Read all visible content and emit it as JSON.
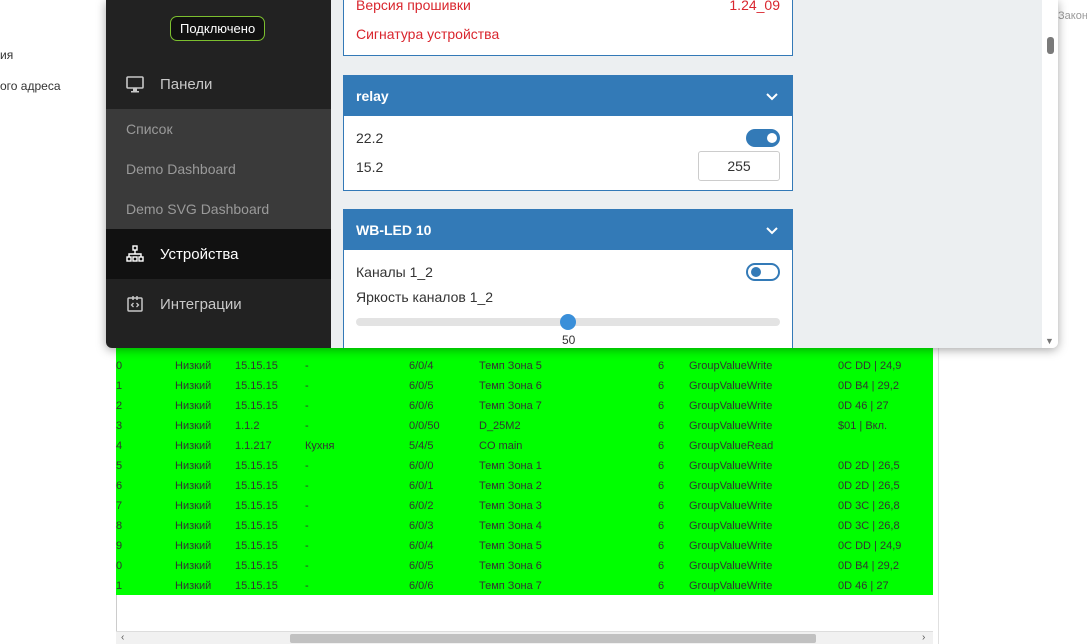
{
  "background": {
    "left_texts": [
      "ия",
      "ого адреса"
    ],
    "right_text": "Закон",
    "table_rows": [
      [
        "0",
        "Низкий",
        "15.15.15",
        "-",
        "6/0/4",
        "Темп Зона 5",
        "6",
        "GroupValueWrite",
        "0C DD | 24,9"
      ],
      [
        "1",
        "Низкий",
        "15.15.15",
        "-",
        "6/0/5",
        "Темп Зона 6",
        "6",
        "GroupValueWrite",
        "0D B4 | 29,2"
      ],
      [
        "2",
        "Низкий",
        "15.15.15",
        "-",
        "6/0/6",
        "Темп Зона 7",
        "6",
        "GroupValueWrite",
        "0D 46 | 27"
      ],
      [
        "3",
        "Низкий",
        "1.1.2",
        "-",
        "0/0/50",
        "D_25M2",
        "6",
        "GroupValueWrite",
        "$01 | Вкл."
      ],
      [
        "4",
        "Низкий",
        "1.1.217",
        "Кухня",
        "5/4/5",
        "CO main",
        "6",
        "GroupValueRead",
        ""
      ],
      [
        "5",
        "Низкий",
        "15.15.15",
        "-",
        "6/0/0",
        "Темп Зона 1",
        "6",
        "GroupValueWrite",
        "0D 2D | 26,5"
      ],
      [
        "6",
        "Низкий",
        "15.15.15",
        "-",
        "6/0/1",
        "Темп Зона 2",
        "6",
        "GroupValueWrite",
        "0D 2D | 26,5"
      ],
      [
        "7",
        "Низкий",
        "15.15.15",
        "-",
        "6/0/2",
        "Темп Зона 3",
        "6",
        "GroupValueWrite",
        "0D 3C | 26,8"
      ],
      [
        "8",
        "Низкий",
        "15.15.15",
        "-",
        "6/0/3",
        "Темп Зона 4",
        "6",
        "GroupValueWrite",
        "0D 3C | 26,8"
      ],
      [
        "9",
        "Низкий",
        "15.15.15",
        "-",
        "6/0/4",
        "Темп Зона 5",
        "6",
        "GroupValueWrite",
        "0C DD | 24,9"
      ],
      [
        "0",
        "Низкий",
        "15.15.15",
        "-",
        "6/0/5",
        "Темп Зона 6",
        "6",
        "GroupValueWrite",
        "0D B4 | 29,2"
      ],
      [
        "1",
        "Низкий",
        "15.15.15",
        "-",
        "6/0/6",
        "Темп Зона 7",
        "6",
        "GroupValueWrite",
        "0D 46 | 27"
      ]
    ],
    "row_color": "#00ff00"
  },
  "sidebar": {
    "status": "Подключено",
    "status_color": "#7cbf2f",
    "items": [
      {
        "label": "Панели",
        "icon": "monitor-icon"
      },
      {
        "label": "Устройства",
        "icon": "devices-icon"
      },
      {
        "label": "Интеграции",
        "icon": "integrations-icon"
      }
    ],
    "submenu": [
      "Список",
      "Demo Dashboard",
      "Demo SVG Dashboard"
    ]
  },
  "content": {
    "top_card": {
      "firmware_label": "Версия прошивки",
      "firmware_value": "1.24_09",
      "signature_label": "Сигнатура устройства"
    },
    "relay_card": {
      "title": "relay",
      "row1_label": "22.2",
      "row1_toggle": true,
      "row2_label": "15.2",
      "row2_value": "255"
    },
    "led_card": {
      "title": "WB-LED 10",
      "channels_label": "Каналы 1_2",
      "channels_toggle": false,
      "brightness_label": "Яркость каналов 1_2",
      "brightness_value": "50",
      "brightness_fraction": 0.5
    }
  },
  "colors": {
    "accent": "#337ab7",
    "sidebar_bg": "#222222",
    "error_text": "#d9262e"
  }
}
